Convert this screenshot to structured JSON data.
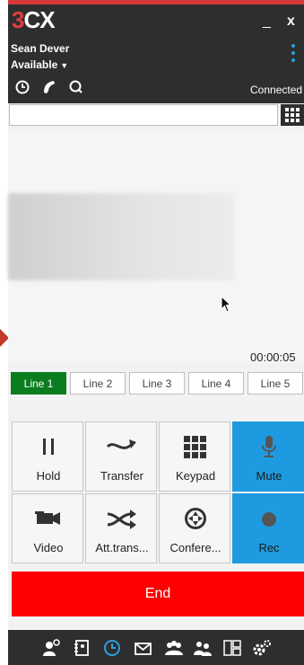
{
  "app": {
    "logo_three": "3",
    "logo_cx": "CX",
    "minimize_label": "_",
    "close_label": "x"
  },
  "header": {
    "user_name": "Sean Dever",
    "status": "Available",
    "status_caret": "▼",
    "connection": "Connected"
  },
  "search": {
    "value": ""
  },
  "call": {
    "timer": "00:00:05"
  },
  "lines": [
    "Line 1",
    "Line 2",
    "Line 3",
    "Line 4",
    "Line 5"
  ],
  "buttons": {
    "hold": "Hold",
    "transfer": "Transfer",
    "keypad": "Keypad",
    "mute": "Mute",
    "video": "Video",
    "att_transfer": "Att.trans...",
    "conference": "Confere...",
    "rec": "Rec"
  },
  "end_label": "End",
  "colors": {
    "header_bg": "#2e2e2e",
    "accent_blue": "#1e9be0",
    "line_active": "#0a7d1f",
    "end_red": "#ff0000",
    "logo_red": "#e23b3b"
  },
  "footer_icons": [
    "presence-icon",
    "phonebook-icon",
    "recent-calls-icon",
    "voicemail-icon",
    "group-icon",
    "conference-icon",
    "panel-icon",
    "settings-icon"
  ]
}
